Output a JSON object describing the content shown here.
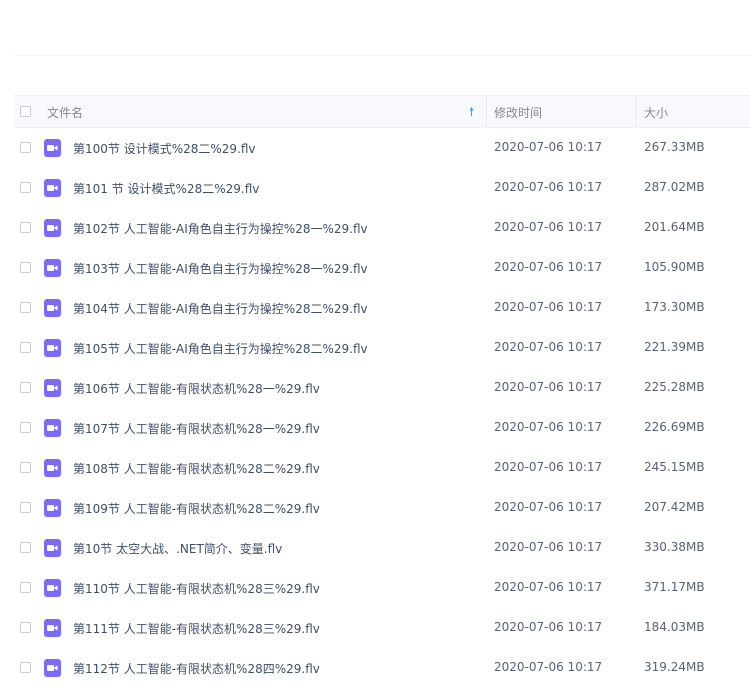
{
  "colors": {
    "header_bg": "#f7f9fc",
    "text": "#424e67",
    "muted": "#888888",
    "accent": "#09aaff",
    "video_icon": "#7b6cf6"
  },
  "table": {
    "headers": {
      "name": "文件名",
      "mtime": "修改时间",
      "size": "大小"
    },
    "sort_icon": "arrow-up-icon",
    "rows": [
      {
        "name": "第100节 设计模式%28二%29.flv",
        "mtime": "2020-07-06 10:17",
        "size": "267.33MB",
        "icon": "video-file-icon"
      },
      {
        "name": "第101 节 设计模式%28二%29.flv",
        "mtime": "2020-07-06 10:17",
        "size": "287.02MB",
        "icon": "video-file-icon"
      },
      {
        "name": "第102节 人工智能-AI角色自主行为操控%28一%29.flv",
        "mtime": "2020-07-06 10:17",
        "size": "201.64MB",
        "icon": "video-file-icon"
      },
      {
        "name": "第103节 人工智能-AI角色自主行为操控%28一%29.flv",
        "mtime": "2020-07-06 10:17",
        "size": "105.90MB",
        "icon": "video-file-icon"
      },
      {
        "name": "第104节 人工智能-AI角色自主行为操控%28二%29.flv",
        "mtime": "2020-07-06 10:17",
        "size": "173.30MB",
        "icon": "video-file-icon"
      },
      {
        "name": "第105节 人工智能-AI角色自主行为操控%28二%29.flv",
        "mtime": "2020-07-06 10:17",
        "size": "221.39MB",
        "icon": "video-file-icon"
      },
      {
        "name": "第106节 人工智能-有限状态机%28一%29.flv",
        "mtime": "2020-07-06 10:17",
        "size": "225.28MB",
        "icon": "video-file-icon"
      },
      {
        "name": "第107节 人工智能-有限状态机%28一%29.flv",
        "mtime": "2020-07-06 10:17",
        "size": "226.69MB",
        "icon": "video-file-icon"
      },
      {
        "name": "第108节 人工智能-有限状态机%28二%29.flv",
        "mtime": "2020-07-06 10:17",
        "size": "245.15MB",
        "icon": "video-file-icon"
      },
      {
        "name": "第109节 人工智能-有限状态机%28二%29.flv",
        "mtime": "2020-07-06 10:17",
        "size": "207.42MB",
        "icon": "video-file-icon"
      },
      {
        "name": "第10节 太空大战、.NET简介、变量.flv",
        "mtime": "2020-07-06 10:17",
        "size": "330.38MB",
        "icon": "video-file-icon"
      },
      {
        "name": "第110节 人工智能-有限状态机%28三%29.flv",
        "mtime": "2020-07-06 10:17",
        "size": "371.17MB",
        "icon": "video-file-icon"
      },
      {
        "name": "第111节 人工智能-有限状态机%28三%29.flv",
        "mtime": "2020-07-06 10:17",
        "size": "184.03MB",
        "icon": "video-file-icon"
      },
      {
        "name": "第112节 人工智能-有限状态机%28四%29.flv",
        "mtime": "2020-07-06 10:17",
        "size": "319.24MB",
        "icon": "video-file-icon"
      }
    ]
  }
}
